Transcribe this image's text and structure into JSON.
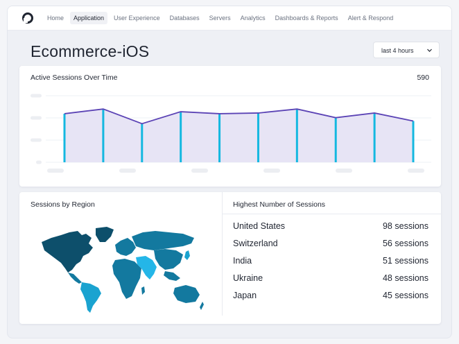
{
  "nav": {
    "items": [
      {
        "label": "Home"
      },
      {
        "label": "Application",
        "active": true
      },
      {
        "label": "User Experience"
      },
      {
        "label": "Databases"
      },
      {
        "label": "Servers"
      },
      {
        "label": "Analytics"
      },
      {
        "label": "Dashboards & Reports"
      },
      {
        "label": "Alert & Respond"
      }
    ]
  },
  "page": {
    "title": "Ecommerce-iOS",
    "time_range": "last 4 hours"
  },
  "sessions_chart": {
    "title": "Active Sessions Over Time",
    "total": "590",
    "chart_data": {
      "type": "area",
      "values": [
        73,
        80,
        58,
        76,
        73,
        74,
        80,
        67,
        74,
        62
      ],
      "ylim": [
        0,
        100
      ],
      "grid": true,
      "line_color": "#5b43b5",
      "fill_color": "#e7e4f5",
      "bar_color": "#14b8e0"
    }
  },
  "region": {
    "title": "Sessions by Region"
  },
  "highest": {
    "title": "Highest Number of Sessions",
    "rows": [
      {
        "country": "United States",
        "count": "98 sessions"
      },
      {
        "country": "Switzerland",
        "count": "56 sessions"
      },
      {
        "country": "India",
        "count": "51 sessions"
      },
      {
        "country": "Ukraine",
        "count": "48 sessions"
      },
      {
        "country": "Japan",
        "count": "45 sessions"
      }
    ]
  },
  "colors": {
    "map_dark": "#0d4f6b",
    "map_mid": "#13799f",
    "map_light": "#1aa3d0",
    "map_bright": "#24b6e8"
  }
}
